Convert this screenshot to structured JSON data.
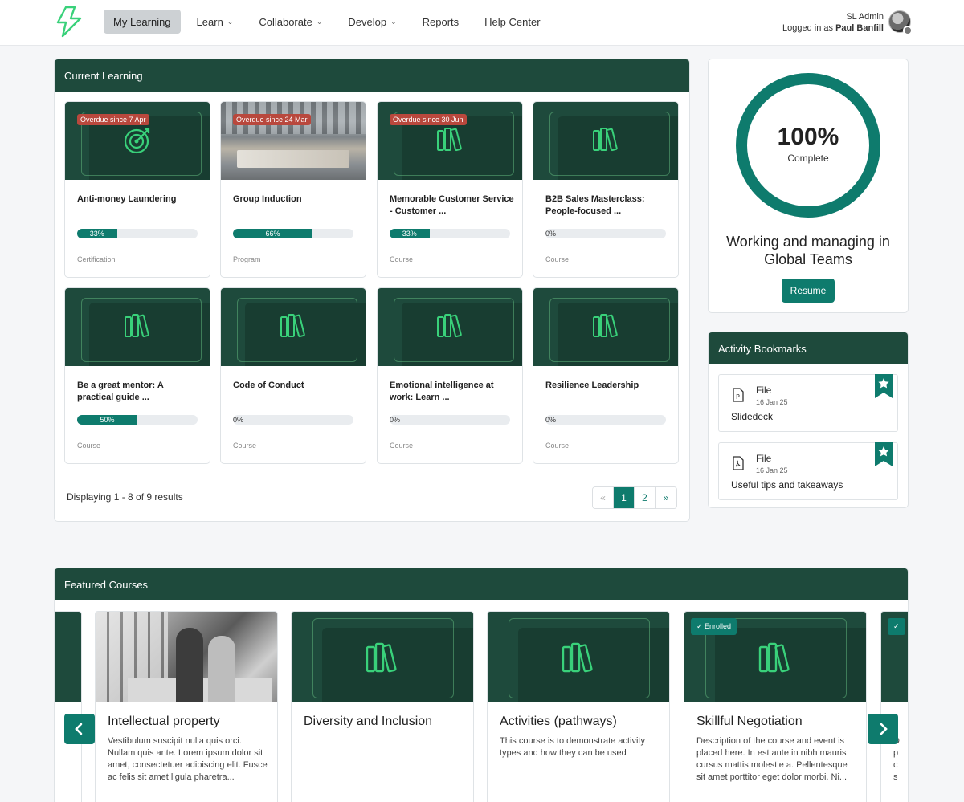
{
  "nav": {
    "items": [
      {
        "label": "My Learning",
        "active": true,
        "dropdown": false
      },
      {
        "label": "Learn",
        "dropdown": true
      },
      {
        "label": "Collaborate",
        "dropdown": true
      },
      {
        "label": "Develop",
        "dropdown": true
      },
      {
        "label": "Reports",
        "dropdown": false
      },
      {
        "label": "Help Center",
        "dropdown": false
      }
    ],
    "user": {
      "role": "SL Admin",
      "logged_in_prefix": "Logged in as",
      "name": "Paul Banfill"
    }
  },
  "current_learning": {
    "title": "Current Learning",
    "cards": [
      {
        "title": "Anti-money Laundering",
        "overdue": "Overdue since 7 Apr",
        "progress": 33,
        "progress_label": "33%",
        "type": "Certification",
        "icon": "target-icon"
      },
      {
        "title": "Group Induction",
        "overdue": "Overdue since 24 Mar",
        "progress": 66,
        "progress_label": "66%",
        "type": "Program",
        "icon": "office-photo"
      },
      {
        "title": "Memorable Customer Service - Customer ...",
        "overdue": "Overdue since 30 Jun",
        "progress": 33,
        "progress_label": "33%",
        "type": "Course",
        "icon": "books-icon"
      },
      {
        "title": "B2B Sales Masterclass: People-focused ...",
        "overdue": "",
        "progress": 0,
        "progress_label": "0%",
        "type": "Course",
        "icon": "books-icon"
      },
      {
        "title": "Be a great mentor: A practical guide ...",
        "overdue": "",
        "progress": 50,
        "progress_label": "50%",
        "type": "Course",
        "icon": "books-icon"
      },
      {
        "title": "Code of Conduct",
        "overdue": "",
        "progress": 0,
        "progress_label": "0%",
        "type": "Course",
        "icon": "books-icon"
      },
      {
        "title": "Emotional intelligence at work: Learn ...",
        "overdue": "",
        "progress": 0,
        "progress_label": "0%",
        "type": "Course",
        "icon": "books-icon"
      },
      {
        "title": "Resilience Leadership",
        "overdue": "",
        "progress": 0,
        "progress_label": "0%",
        "type": "Course",
        "icon": "books-icon"
      }
    ],
    "results_text": "Displaying 1 - 8 of 9 results",
    "pager": {
      "prev": "«",
      "pages": [
        "1",
        "2"
      ],
      "active": "1",
      "next": "»"
    }
  },
  "completion": {
    "percent": 100,
    "percent_label": "100%",
    "sub": "Complete",
    "course_title": "Working and managing in Global Teams",
    "resume_label": "Resume"
  },
  "bookmarks": {
    "title": "Activity Bookmarks",
    "items": [
      {
        "type": "File",
        "date": "16 Jan 25",
        "name": "Slidedeck",
        "icon": "ppt-file-icon"
      },
      {
        "type": "File",
        "date": "16 Jan 25",
        "name": "Useful tips and takeaways",
        "icon": "pdf-file-icon"
      }
    ]
  },
  "featured": {
    "title": "Featured Courses",
    "cards": [
      {
        "title": "Intellectual property",
        "desc": "Vestibulum suscipit nulla quis orci. Nullam quis ante. Lorem ipsum dolor sit amet, consectetuer adipiscing elit. Fusce ac felis sit amet ligula pharetra...",
        "enrolled": ""
      },
      {
        "title": "Diversity and Inclusion",
        "desc": "",
        "enrolled": ""
      },
      {
        "title": "Activities (pathways)",
        "desc": "This course is to demonstrate activity types and how they can be used",
        "enrolled": ""
      },
      {
        "title": "Skillful Negotiation",
        "desc": "Description of the course and event is placed here. In est ante in nibh mauris cursus mattis molestie a. Pellentesque sit amet porttitor eget dolor morbi. Ni...",
        "enrolled": "✓ Enrolled"
      }
    ],
    "partial_next_desc": "D p c s"
  },
  "colors": {
    "brand_dark": "#1e4a3c",
    "accent": "#0e7b6d",
    "overdue": "#b9483d",
    "icon_green": "#39d17a"
  }
}
